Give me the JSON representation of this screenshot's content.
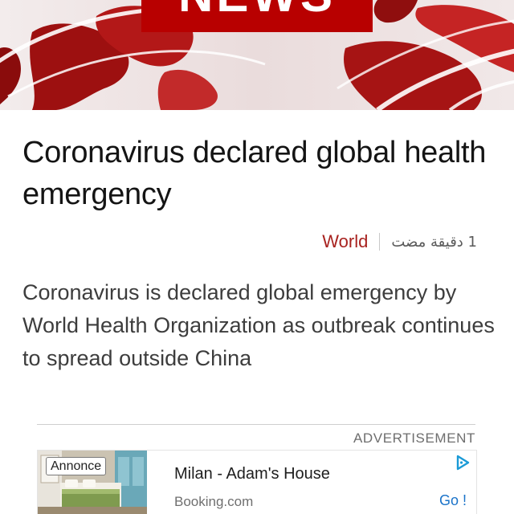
{
  "banner": {
    "brand_word": "NEWS",
    "brand_color": "#b80000"
  },
  "article": {
    "headline": "Coronavirus declared global health emergency",
    "topic": "World",
    "topic_color": "#a8221f",
    "time_ago": "1 دقيقة مضت",
    "summary": "Coronavirus is declared global emergency by World Health Organization as outbreak continues to spread outside China"
  },
  "advertisement": {
    "section_label": "ADVERTISEMENT",
    "badge": "Annonce",
    "title": "Milan - Adam's House",
    "domain": "Booking.com",
    "cta": "Go !",
    "cta_color": "#1a73c9",
    "choices_icon": "adchoices-icon"
  }
}
